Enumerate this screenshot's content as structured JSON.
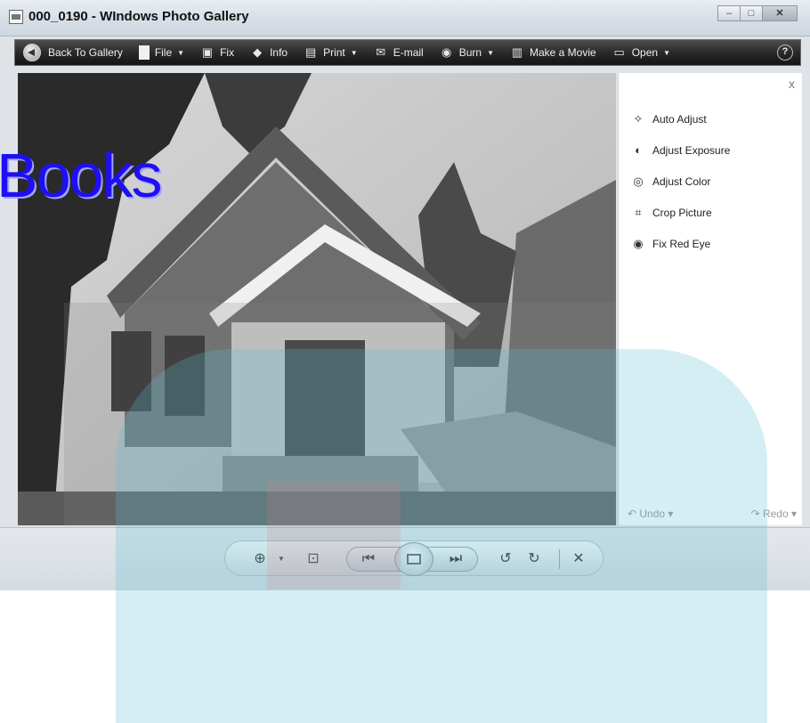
{
  "window": {
    "title": "000_0190 - WIndows Photo Gallery"
  },
  "toolbar": {
    "back": "Back To Gallery",
    "file": "File",
    "fix": "Fix",
    "info": "Info",
    "print": "Print",
    "email": "E-mail",
    "burn": "Burn",
    "movie": "Make a Movie",
    "open": "Open",
    "help": "?"
  },
  "fix_panel": {
    "close": "x",
    "items": [
      {
        "label": "Auto Adjust",
        "icon": "wand-icon"
      },
      {
        "label": "Adjust Exposure",
        "icon": "exposure-icon"
      },
      {
        "label": "Adjust Color",
        "icon": "color-icon"
      },
      {
        "label": "Crop Picture",
        "icon": "crop-icon"
      },
      {
        "label": "Fix Red Eye",
        "icon": "eye-icon"
      }
    ],
    "undo": "Undo",
    "redo": "Redo"
  },
  "overlay": {
    "text": "Books"
  },
  "colors": {
    "toolbar_bg": "#2a2a2a",
    "overlay_text": "#1f0ff5",
    "watermark": "#5abed2"
  }
}
